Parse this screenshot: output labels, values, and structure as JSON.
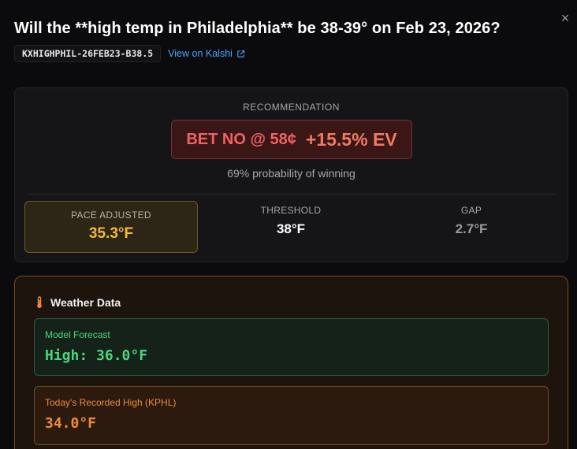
{
  "dialog": {
    "title": "Will the **high temp in Philadelphia** be 38-39° on Feb 23, 2026?",
    "close_label": "×",
    "ticker": "KXHIGHPHIL-26FEB23-B38.5",
    "link_label": "View on Kalshi"
  },
  "recommendation": {
    "label": "RECOMMENDATION",
    "action": "BET NO @ 58¢",
    "ev": "+15.5% EV",
    "probability_text": "69% probability of winning",
    "pace_label": "PACE ADJUSTED",
    "pace_value": "35.3°F",
    "threshold_label": "THRESHOLD",
    "threshold_value": "38°F",
    "gap_label": "GAP",
    "gap_value": "2.7°F"
  },
  "weather": {
    "title": "Weather Data",
    "icon": "thermometer-icon",
    "forecast_label": "Model Forecast",
    "forecast_value": "High: 36.0°F",
    "recorded_label": "Today's Recorded High (KPHL)",
    "recorded_value": "34.0°F"
  },
  "colors": {
    "background": "#0b0b0d",
    "link": "#4da3ff",
    "bet_no": "#f06262",
    "pace": "#f5b83a",
    "forecast": "#4ad67e",
    "recorded": "#f08a3a"
  }
}
